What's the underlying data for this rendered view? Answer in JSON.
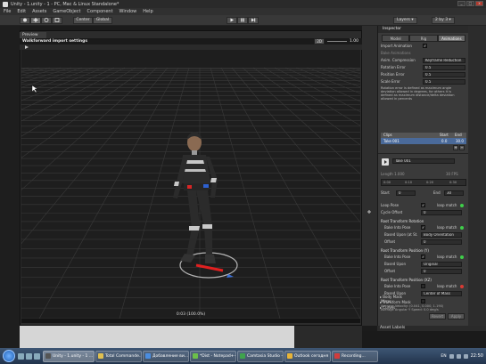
{
  "window": {
    "title": "Unity - 1.unity - 1 - PC, Mac & Linux Standalone*",
    "buttons": [
      "_",
      "□",
      "x"
    ]
  },
  "menu": [
    "File",
    "Edit",
    "Assets",
    "GameObject",
    "Component",
    "Window",
    "Help"
  ],
  "toolbar": {
    "pivot_label": "Center",
    "global_label": "Global",
    "layers_label": "Layers",
    "layout_label": "2 by 3"
  },
  "preview": {
    "tab_label": "Preview",
    "title": "Walkforward import settings",
    "mode_label": "2D",
    "speed": "1.00",
    "time_readout": "0:03 (100.0%)"
  },
  "inspector": {
    "tab_label": "Inspector",
    "tabs": [
      {
        "label": "Model",
        "active": false
      },
      {
        "label": "Rig",
        "active": false
      },
      {
        "label": "Animations",
        "active": true
      }
    ],
    "import_animation_label": "Import Animation",
    "bake_label": "Bake Animations",
    "compression": {
      "label": "Anim. Compression",
      "value": "Keyframe Reduction"
    },
    "rotation_error": {
      "label": "Rotation Error",
      "value": "0.5"
    },
    "position_error": {
      "label": "Position Error",
      "value": "0.5"
    },
    "scale_error": {
      "label": "Scale Error",
      "value": "0.5"
    },
    "note": "Rotation error is defined as maximum angle\ndeviation allowed in degrees, for others it is\ndefined as maximum distance/delta deviation\nallowed in percents",
    "clips": {
      "headers": [
        "Clips",
        "Start",
        "End"
      ],
      "rows": [
        {
          "name": "Take 001",
          "start": "0.0",
          "end": "30.0"
        }
      ]
    },
    "clip_name": "Take 001",
    "length_label": "Length",
    "length_value": "1.000",
    "fps_value": "30 FPS",
    "timeline_ticks": [
      "0:00",
      "0:10",
      "0:20",
      "0:30"
    ],
    "start": {
      "label": "Start",
      "value": "0"
    },
    "end": {
      "label": "End",
      "value": "30"
    },
    "loop_pose": {
      "label": "Loop Pose",
      "match": "loop match",
      "status": "green"
    },
    "cycle_offset": {
      "label": "Cycle Offset",
      "value": "0"
    },
    "rot_section": "Root Transform Rotation",
    "rot_bake": {
      "label": "Bake Into Pose",
      "match": "loop match",
      "status": "green"
    },
    "rot_based": {
      "label": "Based Upon (at St.",
      "value": "Body Orientation"
    },
    "rot_offset": {
      "label": "Offset",
      "value": "0"
    },
    "posy_section": "Root Transform Position (Y)",
    "posy_bake": {
      "label": "Bake Into Pose",
      "match": "loop match",
      "status": "green"
    },
    "posy_based": {
      "label": "Based Upon",
      "value": "Original"
    },
    "posy_offset": {
      "label": "Offset",
      "value": "0"
    },
    "posxz_section": "Root Transform Position (XZ)",
    "posxz_bake": {
      "label": "Bake Into Pose",
      "match": "loop match",
      "status": "red"
    },
    "posxz_based": {
      "label": "Based Upon",
      "value": "Center of Mass"
    },
    "mirror_label": "Mirror",
    "average_velocity": "Average Velocity: (0.041, 0.000, 1.190)",
    "average_angular": "Average Angular Y Speed: 0.0 deg/s",
    "foldouts": [
      "Body Mask",
      "Transform Mask",
      "Curves"
    ],
    "revert_label": "Revert",
    "apply_label": "Apply"
  },
  "asset_labels": "Asset Labels",
  "taskbar": {
    "tasks": [
      {
        "label": "Unity - 1.unity - 1 ...",
        "color": "#555555",
        "active": true
      },
      {
        "label": "Total Commande...",
        "color": "#e0c050",
        "active": false
      },
      {
        "label": "Добавление ви...",
        "color": "#4a8de0",
        "active": false
      },
      {
        "label": "*Dist - Notepad++",
        "color": "#6cbf4a",
        "active": false
      },
      {
        "label": "Camtasia Studio - ...",
        "color": "#3fa34d",
        "active": false
      },
      {
        "label": "Outlook сегодня ...",
        "color": "#e8b437",
        "active": false
      },
      {
        "label": "Recording...",
        "color": "#d23c3c",
        "active": false
      }
    ],
    "lang": "EN",
    "clock": "22:50"
  }
}
